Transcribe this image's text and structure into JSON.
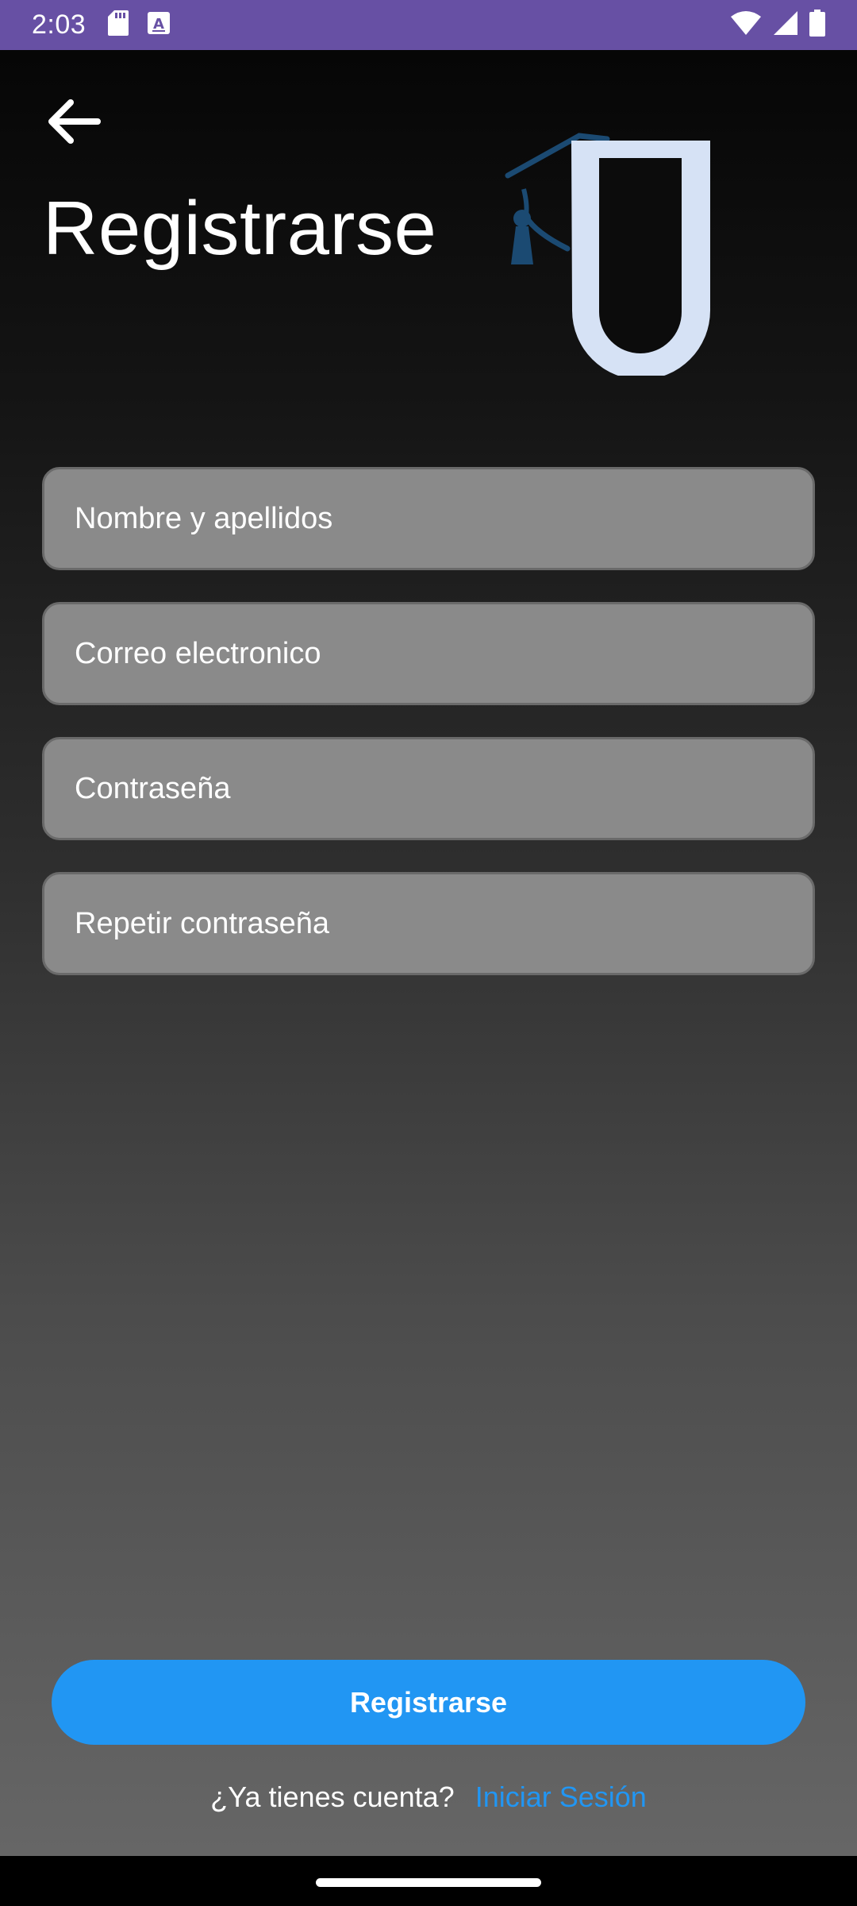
{
  "status_bar": {
    "time": "2:03",
    "background": "#6750a4",
    "left_icons": [
      "sd-card-icon",
      "keyboard-a-icon"
    ],
    "right_icons": [
      "wifi-icon",
      "cell-signal-icon",
      "battery-icon"
    ]
  },
  "header": {
    "back_icon": "arrow-left-icon",
    "title": "Registrarse"
  },
  "form": {
    "fields": [
      {
        "placeholder": "Nombre y apellidos",
        "value": ""
      },
      {
        "placeholder": "Correo electronico",
        "value": ""
      },
      {
        "placeholder": "Contraseña",
        "value": ""
      },
      {
        "placeholder": "Repetir contraseña",
        "value": ""
      }
    ]
  },
  "footer": {
    "submit_label": "Registrarse",
    "login_prompt": "¿Ya tienes cuenta?",
    "login_link": "Iniciar Sesión"
  },
  "colors": {
    "accent": "#2196f3",
    "field_bg": "#8a8a8a",
    "logo_light": "#d6e2f5",
    "logo_dark": "#1b4a72"
  }
}
